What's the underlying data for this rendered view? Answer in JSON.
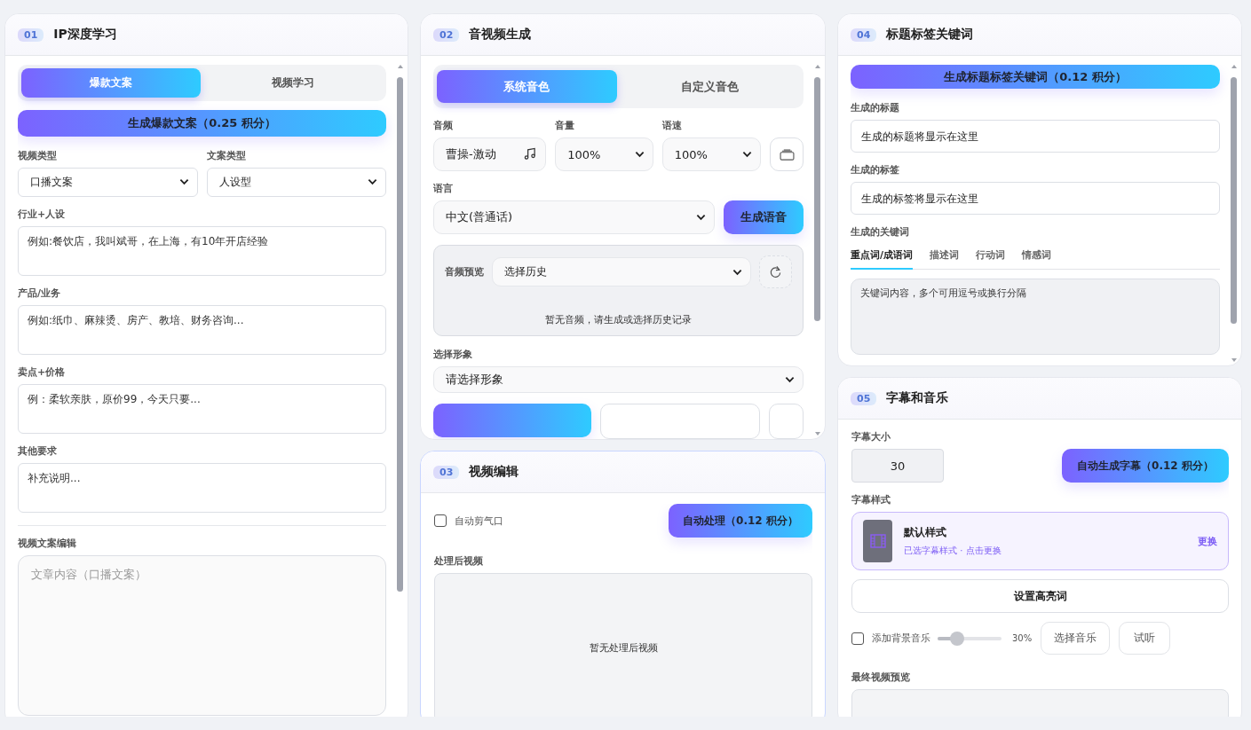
{
  "ip_learning": {
    "badge": "01",
    "title": "IP深度学习",
    "tabs": [
      {
        "label": "爆款文案",
        "selected": true
      },
      {
        "label": "视频学习",
        "selected": false
      }
    ],
    "generate_button": "生成爆款文案（0.25 积分）",
    "selects": [
      {
        "label": "视频类型",
        "value": "口播文案"
      },
      {
        "label": "文案类型",
        "value": "人设型"
      }
    ],
    "fields": [
      {
        "label": "行业+人设",
        "placeholder": "例如:餐饮店，我叫斌哥，在上海，有10年开店经验"
      },
      {
        "label": "产品/业务",
        "placeholder": "例如:纸巾、麻辣烫、房产、教培、财务咨询..."
      },
      {
        "label": "卖点+价格",
        "placeholder": "例：柔软亲肤，原价99，今天只要..."
      },
      {
        "label": "其他要求",
        "placeholder": "补充说明..."
      }
    ],
    "editor": {
      "label": "视频文案编辑",
      "placeholder": "文章内容（口播文案）"
    }
  },
  "av_generation": {
    "badge": "02",
    "title": "音视频生成",
    "tabs": [
      {
        "label": "系统音色",
        "selected": true
      },
      {
        "label": "自定义音色",
        "selected": false
      }
    ],
    "voice": {
      "label": "音频",
      "value": "曹操-激动"
    },
    "volume": {
      "label": "音量",
      "value": "100%"
    },
    "speed": {
      "label": "语速",
      "value": "100%"
    },
    "language": {
      "label": "语言",
      "value": "中文(普通话)"
    },
    "speech_button": "生成语音",
    "preview": {
      "label": "音频预览",
      "history": "选择历史",
      "empty": "暂无音频，请生成或选择历史记录"
    },
    "avatar": {
      "label": "选择形象",
      "value": "请选择形象"
    }
  },
  "video_edit": {
    "badge": "03",
    "title": "视频编辑",
    "auto_cut": {
      "label": "自动剪气口",
      "checked": false
    },
    "process_button": "自动处理（0.12 积分）",
    "result_label": "处理后视频",
    "empty": "暂无处理后视频"
  },
  "title_tags": {
    "badge": "04",
    "title": "标题标签关键词",
    "generate_button": "生成标题标签关键词（0.12 积分）",
    "fields": [
      {
        "label": "生成的标题",
        "placeholder": "生成的标题将显示在这里"
      },
      {
        "label": "生成的标签",
        "placeholder": "生成的标签将显示在这里"
      }
    ],
    "keywords_label": "生成的关键词",
    "keyword_tabs": [
      {
        "label": "重点词/成语词",
        "selected": true
      },
      {
        "label": "描述词",
        "selected": false
      },
      {
        "label": "行动词",
        "selected": false
      },
      {
        "label": "情感词",
        "selected": false
      }
    ],
    "keywords_placeholder": "关键词内容，多个可用逗号或换行分隔"
  },
  "subtitles_music": {
    "badge": "05",
    "title": "字幕和音乐",
    "size_label": "字幕大小",
    "size_value": "30",
    "subtitle_button": "自动生成字幕（0.12 积分）",
    "style_label": "字幕样式",
    "style": {
      "name": "默认样式",
      "note": "已选字幕样式 · 点击更换",
      "change": "更换"
    },
    "highlight_button": "设置高亮词",
    "music": {
      "label": "添加背景音乐",
      "checked": false,
      "level": 0.3,
      "reading": "30%",
      "choose": "选择音乐",
      "listen": "试听"
    },
    "preview_label": "最终视频预览"
  }
}
